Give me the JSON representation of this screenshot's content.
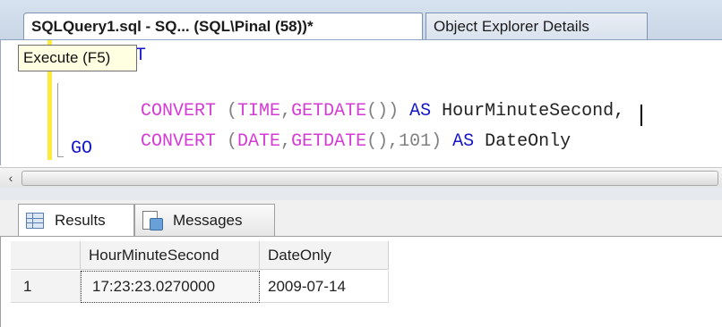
{
  "tabs": {
    "active_label": "SQLQuery1.sql - SQ... (SQL\\Pinal (58))*",
    "inactive_label": "Object Explorer Details"
  },
  "editor": {
    "tooltip": "Execute (F5)",
    "line1_visible": "T",
    "line2": {
      "fn": "CONVERT",
      "open": " (",
      "type": "TIME",
      "comma": ",",
      "fn2": "GETDATE",
      "parens": "())",
      "as": "AS",
      "alias": "HourMinuteSecond,"
    },
    "line3": {
      "fn": "CONVERT",
      "open": " (",
      "type": "DATE",
      "comma": ",",
      "fn2": "GETDATE",
      "parens": "(),101)",
      "as": "AS",
      "alias": "DateOnly"
    },
    "line4": "GO"
  },
  "scrollbar": {
    "left_arrow": "‹"
  },
  "results_tabs": {
    "results_label": "Results",
    "messages_label": "Messages"
  },
  "grid": {
    "columns": [
      "HourMinuteSecond",
      "DateOnly"
    ],
    "rows": [
      {
        "num": "1",
        "cells": [
          "17:23:23.0270000",
          "2009-07-14"
        ]
      }
    ]
  }
}
